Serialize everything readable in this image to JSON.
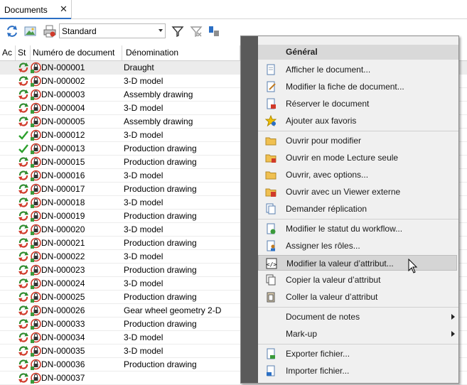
{
  "tab": {
    "label": "Documents",
    "close": "✕"
  },
  "toolbar": {
    "icons": [
      "sync-icon",
      "image-icon",
      "print-icon",
      "filter-icon",
      "filter-clear-icon",
      "column-settings-icon"
    ],
    "view_select": "Standard"
  },
  "grid": {
    "columns": [
      "Ac",
      "St",
      "Numéro de document",
      "Dénomination"
    ],
    "rows": [
      {
        "status": "cycle",
        "num": "DN-000001",
        "name": "Draught"
      },
      {
        "status": "cycle",
        "num": "DN-000002",
        "name": "3-D model"
      },
      {
        "status": "cycle",
        "num": "DN-000003",
        "name": "Assembly drawing"
      },
      {
        "status": "cycle",
        "num": "DN-000004",
        "name": "3-D model"
      },
      {
        "status": "cycle",
        "num": "DN-000005",
        "name": "Assembly drawing"
      },
      {
        "status": "check",
        "num": "DN-000012",
        "name": "3-D model"
      },
      {
        "status": "check",
        "num": "DN-000013",
        "name": "Production drawing"
      },
      {
        "status": "cycle",
        "num": "DN-000015",
        "name": "Production drawing"
      },
      {
        "status": "cycle",
        "num": "DN-000016",
        "name": "3-D model"
      },
      {
        "status": "cycle",
        "num": "DN-000017",
        "name": "Production drawing"
      },
      {
        "status": "cycle",
        "num": "DN-000018",
        "name": "3-D model"
      },
      {
        "status": "cycle",
        "num": "DN-000019",
        "name": "Production drawing"
      },
      {
        "status": "cycle",
        "num": "DN-000020",
        "name": "3-D model"
      },
      {
        "status": "cycle",
        "num": "DN-000021",
        "name": "Production drawing"
      },
      {
        "status": "cycle",
        "num": "DN-000022",
        "name": "3-D model"
      },
      {
        "status": "cycle",
        "num": "DN-000023",
        "name": "Production drawing"
      },
      {
        "status": "cycle",
        "num": "DN-000024",
        "name": "3-D model"
      },
      {
        "status": "cycle",
        "num": "DN-000025",
        "name": "Production drawing"
      },
      {
        "status": "cycle",
        "num": "DN-000026",
        "name": "Gear wheel geometry 2-D"
      },
      {
        "status": "cycle",
        "num": "DN-000033",
        "name": "Production drawing"
      },
      {
        "status": "cycle",
        "num": "DN-000034",
        "name": "3-D model"
      },
      {
        "status": "cycle",
        "num": "DN-000035",
        "name": "3-D model"
      },
      {
        "status": "cycle",
        "num": "DN-000036",
        "name": "Production drawing"
      },
      {
        "status": "cycle",
        "num": "DN-000037",
        "name": ""
      }
    ],
    "selected_row": 0
  },
  "context_menu": {
    "header": "Général",
    "items": [
      {
        "label": "Afficher le document...",
        "icon": "document-icon",
        "group": 1
      },
      {
        "label": "Modifier la fiche de document...",
        "icon": "document-edit-icon",
        "group": 1
      },
      {
        "label": "Réserver le document",
        "icon": "document-reserve-icon",
        "group": 1
      },
      {
        "label": "Ajouter aux favoris",
        "icon": "star-icon",
        "group": 1
      },
      {
        "label": "Ouvrir pour modifier",
        "icon": "folder-open-icon",
        "group": 2
      },
      {
        "label": "Ouvrir en mode Lecture seule",
        "icon": "folder-readonly-icon",
        "group": 2
      },
      {
        "label": "Ouvrir, avec options...",
        "icon": "folder-options-icon",
        "group": 2
      },
      {
        "label": "Ouvrir avec un Viewer externe",
        "icon": "folder-viewer-icon",
        "group": 2
      },
      {
        "label": "Demander réplication",
        "icon": "replication-icon",
        "group": 2
      },
      {
        "label": "Modifier le statut du workflow...",
        "icon": "workflow-icon",
        "group": 3
      },
      {
        "label": "Assigner les rôles...",
        "icon": "roles-icon",
        "group": 3
      },
      {
        "label": "Modifier la valeur d’attribut...",
        "icon": "attribute-edit-icon",
        "group": 3,
        "hover": true
      },
      {
        "label": "Copier la valeur d’attribut",
        "icon": "copy-icon",
        "group": 3
      },
      {
        "label": "Coller la valeur d’attribut",
        "icon": "paste-icon",
        "group": 3
      },
      {
        "label": "Document de notes",
        "icon": "",
        "group": 4,
        "submenu": true
      },
      {
        "label": "Mark-up",
        "icon": "",
        "group": 4,
        "submenu": true
      },
      {
        "label": "Exporter fichier...",
        "icon": "export-icon",
        "group": 5
      },
      {
        "label": "Importer fichier...",
        "icon": "import-icon",
        "group": 5
      }
    ]
  },
  "colors": {
    "accent": "#2b6fc4",
    "menu_gutter": "#5a5a5a",
    "check": "#2ca02c",
    "cycle_green": "#2e8b2e",
    "cycle_red": "#d03a2a"
  }
}
